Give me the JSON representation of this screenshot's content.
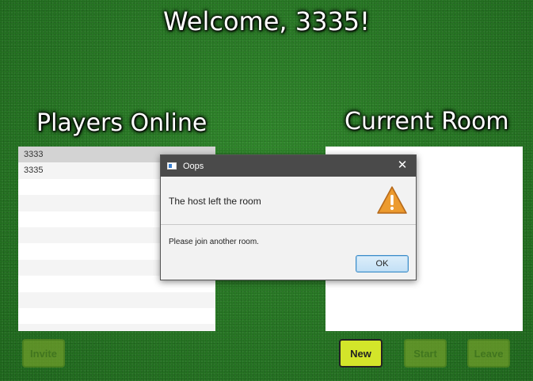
{
  "header": {
    "welcome": "Welcome, 3335!"
  },
  "players": {
    "label": "Players Online",
    "items": [
      "3333",
      "3335",
      "",
      "",
      "",
      "",
      "",
      "",
      "",
      "",
      "",
      ""
    ],
    "selected_index": 0
  },
  "room": {
    "label": "Current Room"
  },
  "buttons": {
    "invite": "Invite",
    "new": "New",
    "start": "Start",
    "leave": "Leave"
  },
  "dialog": {
    "title": "Oops",
    "close_glyph": "✕",
    "header": "The host left the room",
    "content": "Please join another room.",
    "ok": "OK",
    "icon": "warning-icon"
  },
  "colors": {
    "felt": "#2f8a2c",
    "active_button": "#d3e52a",
    "dialog_titlebar": "#4a4a4a",
    "warning": "#e08a1e"
  }
}
